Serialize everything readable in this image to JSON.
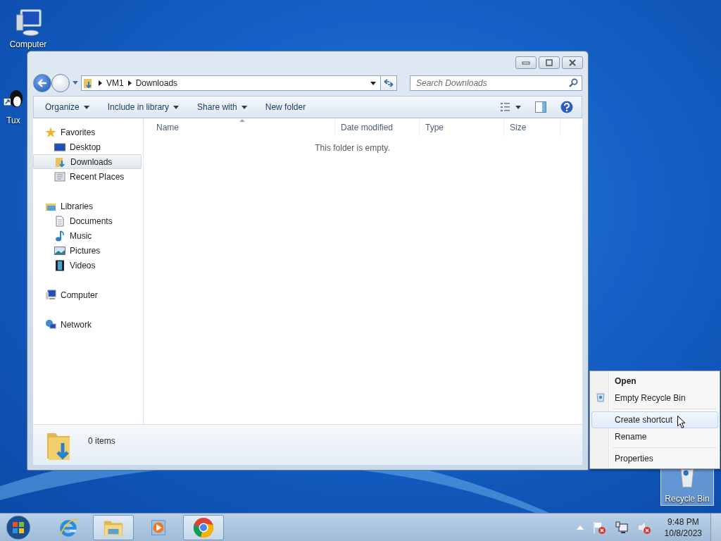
{
  "desktop_icons": [
    {
      "label": "Computer",
      "kind": "computer",
      "selected": false
    },
    {
      "label": "Tux",
      "kind": "tux",
      "selected": false
    },
    {
      "label": "Recycle Bin",
      "kind": "recycle",
      "selected": true
    }
  ],
  "window": {
    "address": {
      "segments": [
        "VM1",
        "Downloads"
      ]
    },
    "search": {
      "placeholder": "Search Downloads"
    },
    "toolbar": [
      {
        "label": "Organize",
        "dropdown": true
      },
      {
        "label": "Include in library",
        "dropdown": true
      },
      {
        "label": "Share with",
        "dropdown": true
      },
      {
        "label": "New folder",
        "dropdown": false
      }
    ],
    "nav": [
      {
        "label": "Favorites",
        "kind": "favorites",
        "selected": false,
        "children": [
          {
            "label": "Desktop",
            "kind": "desktop",
            "selected": false
          },
          {
            "label": "Downloads",
            "kind": "downloads",
            "selected": true
          },
          {
            "label": "Recent Places",
            "kind": "recent",
            "selected": false
          }
        ]
      },
      {
        "label": "Libraries",
        "kind": "libraries",
        "selected": false,
        "children": [
          {
            "label": "Documents",
            "kind": "documents",
            "selected": false
          },
          {
            "label": "Music",
            "kind": "music",
            "selected": false
          },
          {
            "label": "Pictures",
            "kind": "pictures",
            "selected": false
          },
          {
            "label": "Videos",
            "kind": "videos",
            "selected": false
          }
        ]
      },
      {
        "label": "Computer",
        "kind": "computer",
        "selected": false
      },
      {
        "label": "Network",
        "kind": "network",
        "selected": false
      }
    ],
    "columns": [
      {
        "label": "Name",
        "sorted": true
      },
      {
        "label": "Date modified",
        "sorted": false
      },
      {
        "label": "Type",
        "sorted": false
      },
      {
        "label": "Size",
        "sorted": false
      }
    ],
    "empty_message": "This folder is empty.",
    "status": "0 items"
  },
  "context_menu": [
    {
      "kind": "default",
      "label": "Open",
      "selected": false
    },
    {
      "kind": "with_icon",
      "label": "Empty Recycle Bin",
      "selected": false
    },
    {
      "kind": "separator"
    },
    {
      "kind": "plain",
      "label": "Create shortcut",
      "selected": true
    },
    {
      "kind": "plain",
      "label": "Rename",
      "selected": false
    },
    {
      "kind": "separator"
    },
    {
      "kind": "plain",
      "label": "Properties",
      "selected": false
    }
  ],
  "taskbar": {
    "items": [
      {
        "kind": "ie",
        "running": false
      },
      {
        "kind": "explorer",
        "running": true
      },
      {
        "kind": "media",
        "running": false
      },
      {
        "kind": "chrome",
        "running": true
      }
    ],
    "time": "9:48 PM",
    "date": "10/8/2023"
  }
}
